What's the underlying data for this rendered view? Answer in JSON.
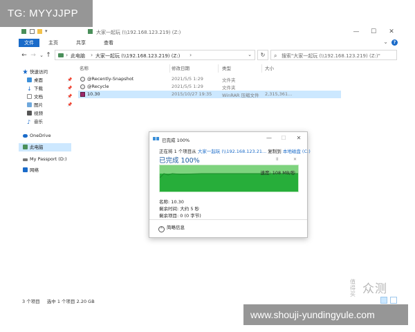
{
  "watermark_top": "TG: MYYJJPP",
  "watermark_bottom": "www.shouji-yundingyule.com",
  "watermark_logo": "众测",
  "watermark_logo_prefix": "值得买",
  "window": {
    "title": "大家一起玩 (\\\\192.168.123.219) (Z:)",
    "ribbon_tabs": [
      "文件",
      "主页",
      "共享",
      "查看"
    ],
    "active_tab": "文件"
  },
  "address": {
    "segments": [
      "此电脑",
      "大家一起玩 (\\\\192.168.123.219) (Z:)"
    ],
    "search_placeholder": "搜索\"大家一起玩 (\\\\192.168.123.219) (Z:)\""
  },
  "nav": {
    "quick_access": "快速访问",
    "items": [
      {
        "label": "桌面",
        "icon": "desktop-icon",
        "pinned": true
      },
      {
        "label": "下载",
        "icon": "download-icon",
        "pinned": true
      },
      {
        "label": "文档",
        "icon": "document-icon",
        "pinned": true
      },
      {
        "label": "图片",
        "icon": "picture-icon",
        "pinned": true
      },
      {
        "label": "视频",
        "icon": "video-icon",
        "pinned": false
      },
      {
        "label": "音乐",
        "icon": "music-icon",
        "pinned": false
      }
    ],
    "onedrive": "OneDrive",
    "this_pc": "此电脑",
    "passport": "My Passport (D:)",
    "network": "网络"
  },
  "columns": [
    "名称",
    "修改日期",
    "类型",
    "大小"
  ],
  "files": [
    {
      "name": "@Recently-Snapshot",
      "date": "2021/5/5 1:29",
      "type": "文件夹",
      "size": "",
      "icon": "special-folder-icon",
      "selected": false
    },
    {
      "name": "@Recycle",
      "date": "2021/5/5 1:29",
      "type": "文件夹",
      "size": "",
      "icon": "recycle-folder-icon",
      "selected": false
    },
    {
      "name": "10.30",
      "date": "2015/10/27 19:35",
      "type": "WinRAR 压缩文件",
      "size": "2,315,361...",
      "icon": "winrar-icon",
      "selected": true
    }
  ],
  "status": {
    "count": "3 个项目",
    "selection": "选中 1 个项目  2.20 GB"
  },
  "dialog": {
    "title": "已完成 100%",
    "line_prefix": "正在将 1 个项目从 ",
    "source": "大家一起玩 (\\\\192.168.123.21...",
    "line_mid": " 复制到 ",
    "destination": "本地磁盘 (C:)",
    "progress_text": "已完成 100%",
    "pause_icon": "II",
    "cancel_icon": "✕",
    "speed": "速度: 108 MB/秒",
    "progress_percent": 100,
    "name_line": "名称: 10.30",
    "remaining_time": "剩余时间: 大约 5 秒",
    "remaining_items": "剩余项目: 0 (0 字节)",
    "less_details": "简略信息"
  }
}
